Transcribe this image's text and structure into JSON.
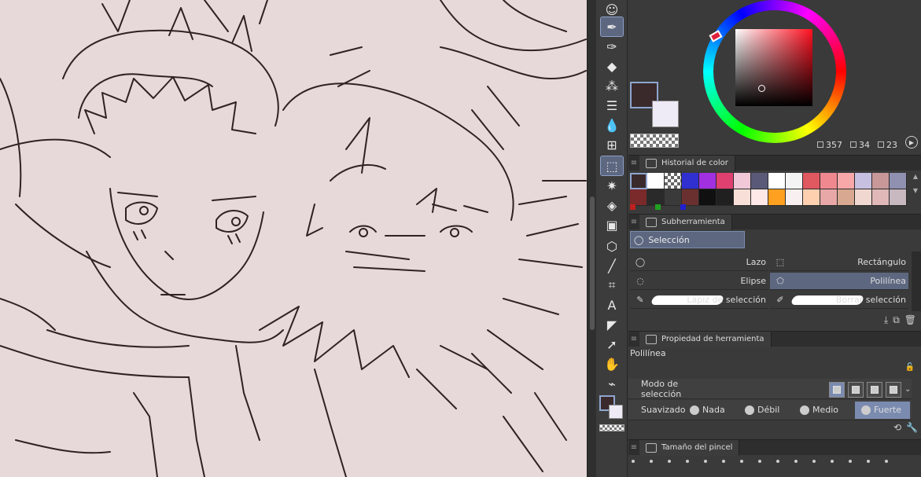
{
  "colors": {
    "canvas_bg": "#e7d8d9",
    "line_art": "#2e2222",
    "accent": "#5d6780",
    "main_color": "#3a2a2c",
    "sub_color": "#eeeaf6"
  },
  "toolbar": {
    "tools": [
      {
        "name": "tool-user-icon"
      },
      {
        "name": "tool-pen-icon",
        "active": true
      },
      {
        "name": "tool-pen-nib-icon"
      },
      {
        "name": "tool-eraser-icon"
      },
      {
        "name": "tool-decoration-icon"
      },
      {
        "name": "tool-lines-icon"
      },
      {
        "name": "tool-blend-icon"
      },
      {
        "name": "tool-grid-icon"
      },
      {
        "name": "tool-selection-icon",
        "active": true
      },
      {
        "name": "tool-magic-wand-icon"
      },
      {
        "name": "tool-fill-icon"
      },
      {
        "name": "tool-gradient-icon"
      },
      {
        "name": "tool-3d-cube-icon"
      },
      {
        "name": "tool-line-icon"
      },
      {
        "name": "tool-crop-icon"
      },
      {
        "name": "tool-text-icon"
      },
      {
        "name": "tool-balloon-icon"
      },
      {
        "name": "tool-object-icon"
      },
      {
        "name": "tool-hand-icon"
      },
      {
        "name": "tool-eyedropper-icon"
      }
    ]
  },
  "color_panel": {
    "h": "357",
    "s": "34",
    "v": "23"
  },
  "color_history": {
    "title": "Historial de color",
    "row1": [
      "#3a2a2c",
      "#ffffff",
      "checker",
      "#3030d0",
      "#a030e0",
      "#e04070",
      "#f0c8d8",
      "#5a5a78",
      "#ffffff",
      "#f4f4f4",
      "#e05860",
      "#f08890",
      "#f8a8a8",
      "#c8c0e0",
      "#c89898",
      "#9090b0"
    ],
    "row2": [
      "#7a2a2a",
      "#2a2a2a",
      "#3a3a3a",
      "#6a3030",
      "#101010",
      "#202020",
      "#f8e0d8",
      "#ffe8e8",
      "#ffa020",
      "#f8f0f0",
      "#ffd0b0",
      "#e8a8a8",
      "#d8a890",
      "#f0d8d0",
      "#e0b8b8",
      "#c8b8c0"
    ],
    "marks": [
      "#c02020",
      "#20a020",
      "#2020d0"
    ]
  },
  "subtool": {
    "title": "Subherramienta",
    "group_label": "Selección",
    "items": [
      {
        "label": "Lazo"
      },
      {
        "label": "Rectángulo"
      },
      {
        "label": "Elipse"
      },
      {
        "label": "Polilínea",
        "active": true
      },
      {
        "label": "Lápiz de selección"
      },
      {
        "label": "Borrar selección"
      }
    ]
  },
  "tool_property": {
    "title": "Propiedad de herramienta",
    "tool_name": "Polilínea",
    "selection_mode_label": "Modo de selección",
    "smoothing_label": "Suavizado",
    "smoothing_options": [
      {
        "label": "Nada"
      },
      {
        "label": "Débil"
      },
      {
        "label": "Medio"
      },
      {
        "label": "Fuerte",
        "active": true
      }
    ]
  },
  "brush_size": {
    "title": "Tamaño del pincel"
  }
}
